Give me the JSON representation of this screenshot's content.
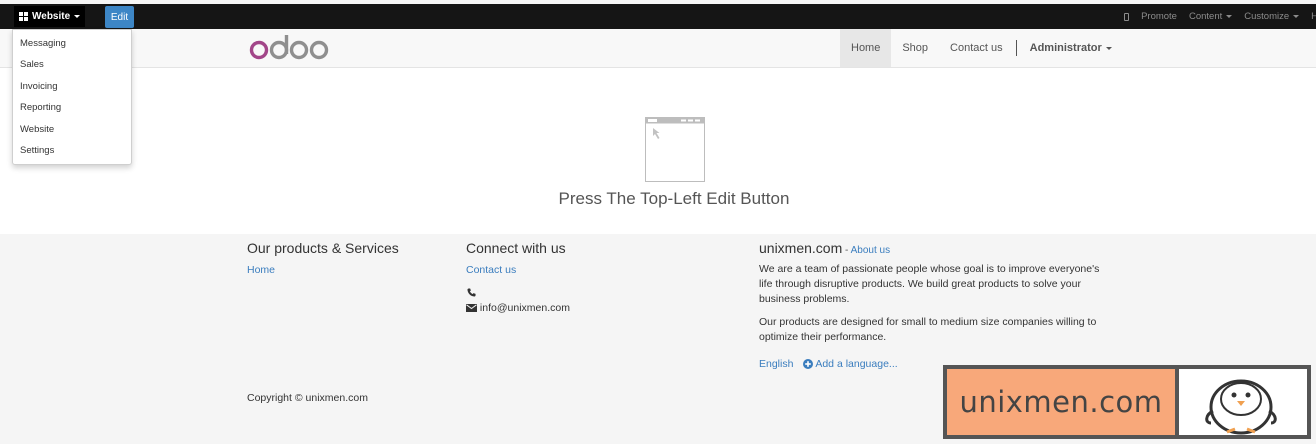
{
  "adminbar": {
    "app_switcher_label": "Website",
    "edit_label": "Edit",
    "right_items": [
      "Promote",
      "Content",
      "Customize",
      "H"
    ]
  },
  "app_menu": {
    "items": [
      "Messaging",
      "Sales",
      "Invoicing",
      "Reporting",
      "Website",
      "Settings"
    ]
  },
  "site_nav": {
    "items": [
      "Home",
      "Shop",
      "Contact us"
    ],
    "active": "Home",
    "user": "Administrator"
  },
  "main": {
    "headline": "Press The Top-Left Edit Button"
  },
  "footer": {
    "col1": {
      "title": "Our products & Services",
      "link": "Home"
    },
    "col2": {
      "title": "Connect with us",
      "link": "Contact us",
      "email": "info@unixmen.com"
    },
    "col3": {
      "title": "unixmen.com",
      "dash": " - ",
      "about_link": "About us",
      "para1": "We are a team of passionate people whose goal is to improve everyone's life through disruptive products. We build great products to solve your business problems.",
      "para2": "Our products are designed for small to medium size companies willing to optimize their performance.",
      "language": "English",
      "add_language": "Add a language..."
    },
    "copyright": "Copyright © unixmen.com"
  },
  "watermark": {
    "text": "unixmen.com"
  },
  "colors": {
    "adminbar_bg": "#151515",
    "edit_button": "#3d86c6",
    "link": "#3a7dbe",
    "odoo_purple": "#a24689",
    "watermark_orange": "#f8a87a"
  }
}
